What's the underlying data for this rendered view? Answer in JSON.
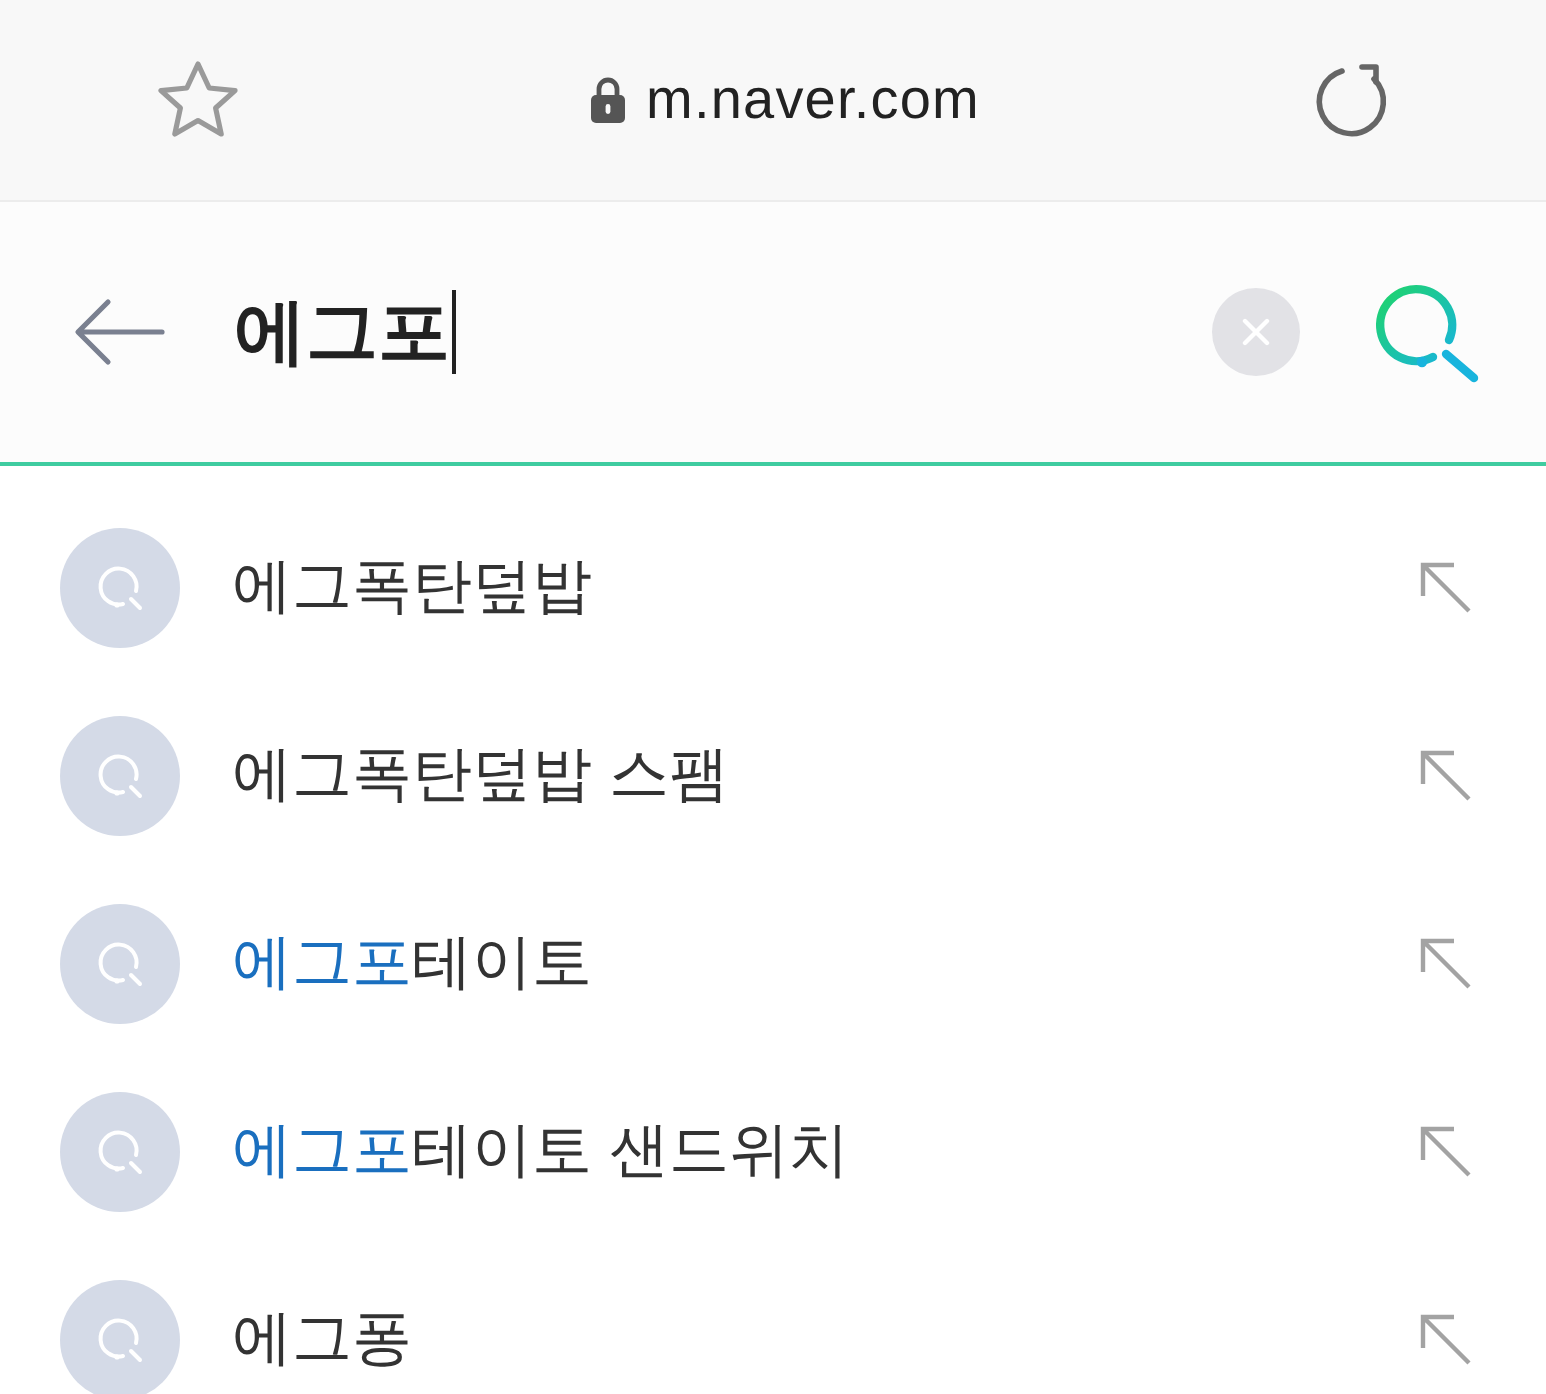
{
  "address_bar": {
    "url": "m.naver.com"
  },
  "search": {
    "query": "에그포"
  },
  "suggestions": [
    {
      "segments": [
        {
          "text": "에그폭탄덮밥",
          "highlighted": false
        }
      ]
    },
    {
      "segments": [
        {
          "text": "에그폭탄덮밥 스팸",
          "highlighted": false
        }
      ]
    },
    {
      "segments": [
        {
          "text": "에그포",
          "highlighted": true
        },
        {
          "text": "테이토",
          "highlighted": false
        }
      ]
    },
    {
      "segments": [
        {
          "text": "에그포",
          "highlighted": true
        },
        {
          "text": "테이토 샌드위치",
          "highlighted": false
        }
      ]
    },
    {
      "segments": [
        {
          "text": "에그퐁",
          "highlighted": false
        }
      ]
    }
  ]
}
